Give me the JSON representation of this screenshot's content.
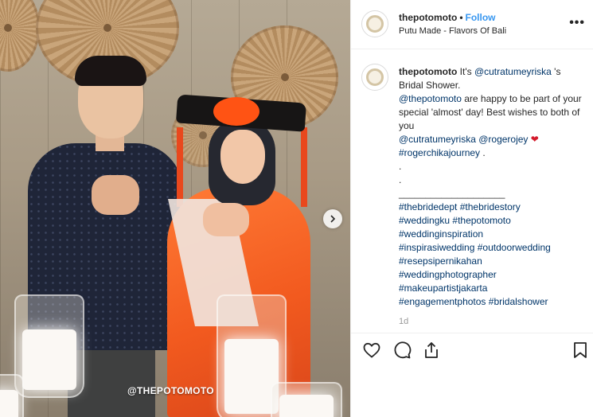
{
  "post": {
    "username": "thepotomoto",
    "follow_label": "Follow",
    "separator": "•",
    "location": "Putu Made - Flavors Of Bali",
    "more_label": "•••",
    "watermark": "@THEPOTOMOTO",
    "time": "1d"
  },
  "caption": {
    "username": "thepotomoto",
    "lines": [
      "It's ",
      "@cutratumeyriska",
      " 's Bridal Shower."
    ],
    "body_mention": "@thepotomoto",
    "body_text": " are happy to be part of your special 'almost' day! Best wishes to both of you ",
    "mention_2": "@cutratumeyriska",
    "mention_3": "@rogerojey",
    "heart": "❤",
    "hashtag_1": "#rogerchikajourney",
    "period": ".",
    "dot_1": ".",
    "dot_2": ".",
    "divider": "____________________",
    "hashtags": [
      [
        "#thebridedept",
        "#thebridestory"
      ],
      [
        "#weddingku",
        "#thepotomoto"
      ],
      [
        "#weddinginspiration"
      ],
      [
        "#inspirasiwedding",
        "#outdoorwedding"
      ],
      [
        "#resepsipernikahan"
      ],
      [
        "#weddingphotographer"
      ],
      [
        "#makeupartistjakarta"
      ],
      [
        "#engagementphotos",
        "#bridalshower"
      ]
    ]
  },
  "icons": {
    "like": "heart-outline-icon",
    "comment": "speech-bubble-icon",
    "share": "share-icon",
    "save": "bookmark-icon",
    "next": "chevron-right-icon"
  },
  "colors": {
    "link": "#003569",
    "follow": "#3897f0",
    "heart": "#d41b2c"
  }
}
